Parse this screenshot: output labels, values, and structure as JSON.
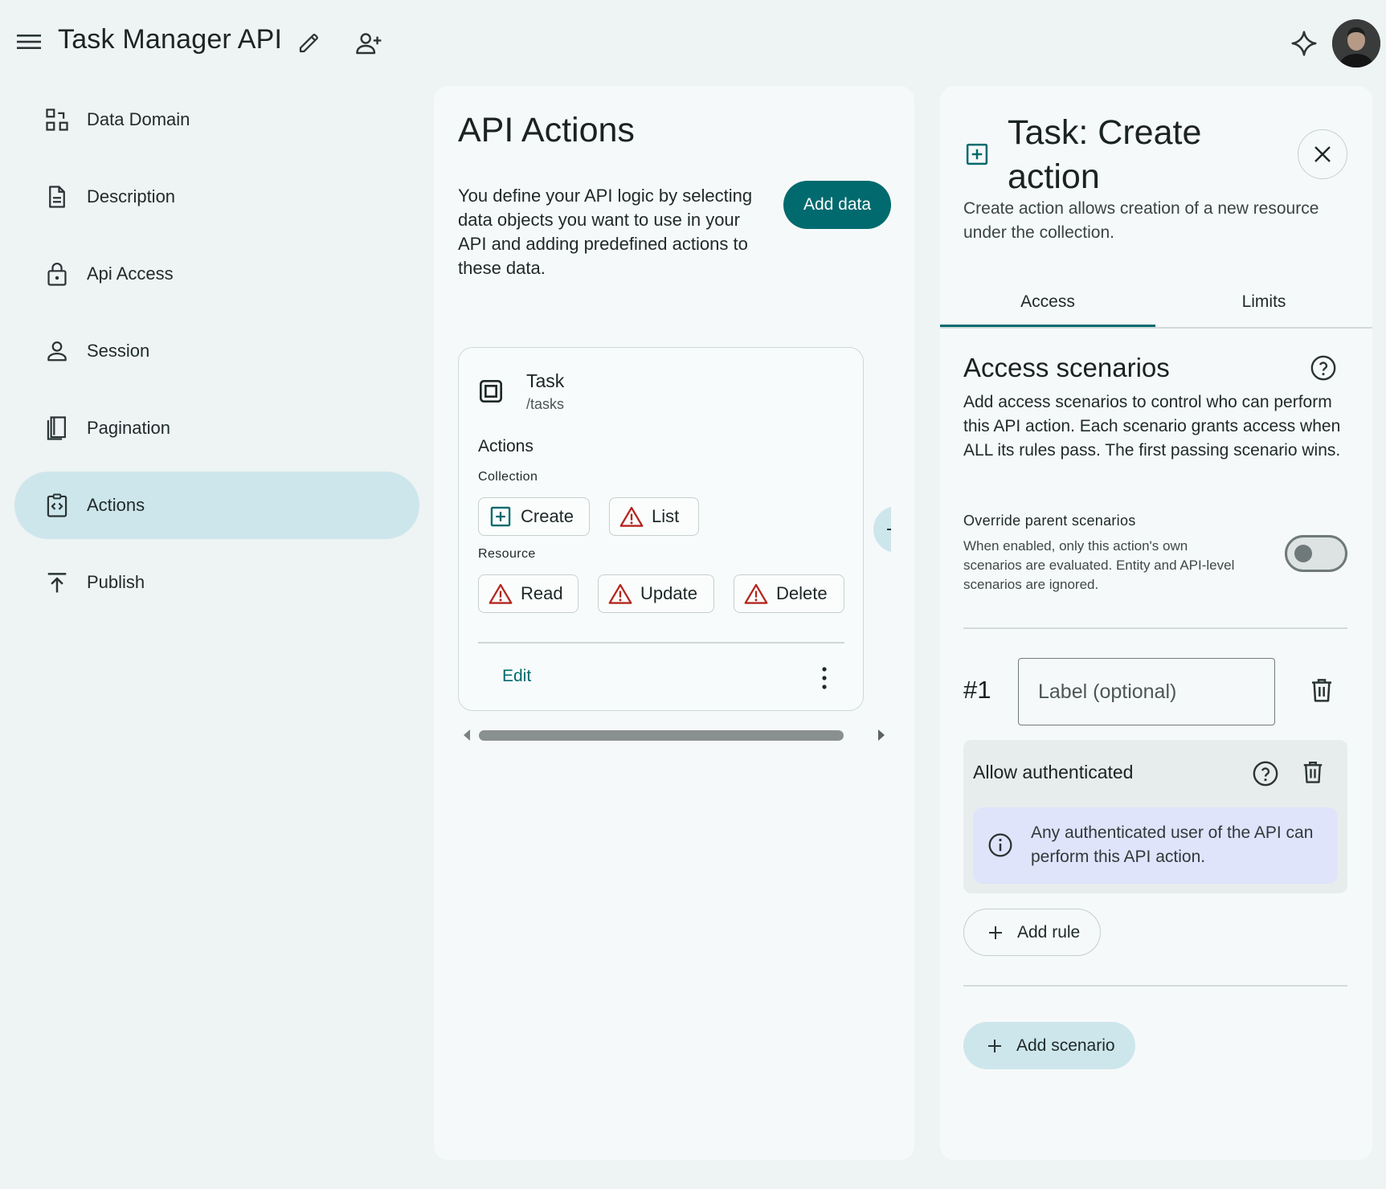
{
  "header": {
    "app_title": "Task Manager API",
    "menu_icon": "menu-icon",
    "edit_icon": "pencil-icon",
    "share_icon": "add-person-icon",
    "ai_icon": "sparkle-icon",
    "avatar": "user-avatar"
  },
  "sidebar": {
    "items": [
      {
        "label": "Data Domain",
        "icon": "data-domain-icon"
      },
      {
        "label": "Description",
        "icon": "document-icon"
      },
      {
        "label": "Api Access",
        "icon": "lock-icon"
      },
      {
        "label": "Session",
        "icon": "person-icon"
      },
      {
        "label": "Pagination",
        "icon": "pages-icon"
      },
      {
        "label": "Actions",
        "icon": "code-clipboard-icon",
        "active": true
      },
      {
        "label": "Publish",
        "icon": "upload-icon"
      }
    ]
  },
  "main": {
    "title": "API Actions",
    "description": "You define your API logic by selecting data objects you want to use in your API and adding predefined actions to these data.",
    "add_data_label": "Add data",
    "card": {
      "name": "Task",
      "path": "/tasks",
      "actions_heading": "Actions",
      "collection_label": "Collection",
      "collection_actions": [
        {
          "label": "Create",
          "icon": "plus-box-icon"
        },
        {
          "label": "List",
          "icon": "warning-icon"
        }
      ],
      "resource_label": "Resource",
      "resource_actions": [
        {
          "label": "Read",
          "icon": "warning-icon"
        },
        {
          "label": "Update",
          "icon": "warning-icon"
        },
        {
          "label": "Delete",
          "icon": "warning-icon"
        }
      ],
      "edit_label": "Edit"
    }
  },
  "detail": {
    "title": "Task: Create action",
    "subtitle": "Create action allows creation of a new resource under the collection.",
    "tabs": [
      {
        "label": "Access",
        "active": true
      },
      {
        "label": "Limits",
        "active": false
      }
    ],
    "access_heading": "Access scenarios",
    "access_desc": "Add access scenarios to control who can perform this API action. Each scenario grants access when ALL its rules pass. The first passing scenario wins.",
    "override_title": "Override parent scenarios",
    "override_desc": "When enabled, only this action's own scenarios are evaluated. Entity and API-level scenarios are ignored.",
    "override_enabled": false,
    "scenario": {
      "number": "#1",
      "label_placeholder": "Label (optional)",
      "label_value": "",
      "rule_title": "Allow authenticated",
      "rule_info": "Any authenticated user of the API can perform this API action."
    },
    "add_rule_label": "Add rule",
    "add_scenario_label": "Add scenario"
  },
  "colors": {
    "accent": "#006a6e",
    "nav_active": "#cde6ec",
    "warning": "#b3261e",
    "info_bg": "#dfe4fb"
  }
}
